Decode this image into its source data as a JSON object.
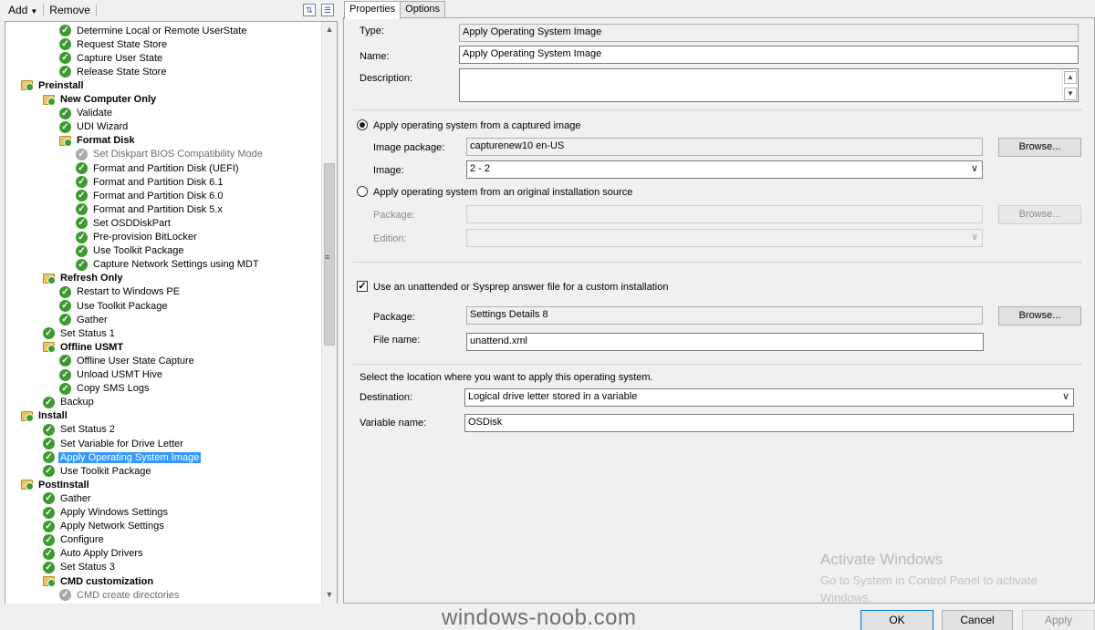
{
  "toolbar": {
    "add_label": "Add",
    "remove_label": "Remove",
    "icons": [
      "properties-icon",
      "options-icon"
    ]
  },
  "tree": {
    "items": [
      {
        "label": "Determine Local or Remote UserState",
        "level": 3,
        "icon": "check",
        "bold": false
      },
      {
        "label": "Request State Store",
        "level": 3,
        "icon": "check",
        "bold": false
      },
      {
        "label": "Capture User State",
        "level": 3,
        "icon": "check",
        "bold": false
      },
      {
        "label": "Release State Store",
        "level": 3,
        "icon": "check",
        "bold": false
      },
      {
        "label": "Preinstall",
        "level": 1,
        "icon": "folder",
        "bold": true
      },
      {
        "label": "New Computer Only",
        "level": 2,
        "icon": "folder",
        "bold": true
      },
      {
        "label": "Validate",
        "level": 3,
        "icon": "check",
        "bold": false
      },
      {
        "label": "UDI Wizard",
        "level": 3,
        "icon": "check",
        "bold": false
      },
      {
        "label": "Format Disk",
        "level": 3,
        "icon": "folder",
        "bold": true
      },
      {
        "label": "Set Diskpart BIOS Compatibility Mode",
        "level": 4,
        "icon": "grey",
        "bold": false,
        "disabled": true
      },
      {
        "label": "Format and Partition Disk (UEFI)",
        "level": 4,
        "icon": "check",
        "bold": false
      },
      {
        "label": "Format and Partition Disk 6.1",
        "level": 4,
        "icon": "check",
        "bold": false
      },
      {
        "label": "Format and Partition Disk 6.0",
        "level": 4,
        "icon": "check",
        "bold": false
      },
      {
        "label": "Format and Partition Disk 5.x",
        "level": 4,
        "icon": "check",
        "bold": false
      },
      {
        "label": "Set OSDDiskPart",
        "level": 4,
        "icon": "check",
        "bold": false
      },
      {
        "label": "Pre-provision BitLocker",
        "level": 4,
        "icon": "check",
        "bold": false
      },
      {
        "label": "Use Toolkit Package",
        "level": 4,
        "icon": "check",
        "bold": false
      },
      {
        "label": "Capture Network Settings using MDT",
        "level": 4,
        "icon": "check",
        "bold": false
      },
      {
        "label": "Refresh Only",
        "level": 2,
        "icon": "folder",
        "bold": true
      },
      {
        "label": "Restart to Windows PE",
        "level": 3,
        "icon": "check",
        "bold": false
      },
      {
        "label": "Use Toolkit Package",
        "level": 3,
        "icon": "check",
        "bold": false
      },
      {
        "label": "Gather",
        "level": 3,
        "icon": "check",
        "bold": false
      },
      {
        "label": "Set Status 1",
        "level": 2,
        "icon": "check",
        "bold": false
      },
      {
        "label": "Offline USMT",
        "level": 2,
        "icon": "folder",
        "bold": true
      },
      {
        "label": "Offline User State Capture",
        "level": 3,
        "icon": "check",
        "bold": false
      },
      {
        "label": "Unload USMT Hive",
        "level": 3,
        "icon": "check",
        "bold": false
      },
      {
        "label": "Copy SMS Logs",
        "level": 3,
        "icon": "check",
        "bold": false
      },
      {
        "label": "Backup",
        "level": 2,
        "icon": "check",
        "bold": false
      },
      {
        "label": "Install",
        "level": 1,
        "icon": "folder",
        "bold": true
      },
      {
        "label": "Set Status 2",
        "level": 2,
        "icon": "check",
        "bold": false
      },
      {
        "label": "Set Variable for Drive Letter",
        "level": 2,
        "icon": "check",
        "bold": false
      },
      {
        "label": "Apply Operating System Image",
        "level": 2,
        "icon": "check",
        "bold": false,
        "selected": true
      },
      {
        "label": "Use Toolkit Package",
        "level": 2,
        "icon": "check",
        "bold": false
      },
      {
        "label": "PostInstall",
        "level": 1,
        "icon": "folder",
        "bold": true
      },
      {
        "label": "Gather",
        "level": 2,
        "icon": "check",
        "bold": false
      },
      {
        "label": "Apply Windows Settings",
        "level": 2,
        "icon": "check",
        "bold": false
      },
      {
        "label": "Apply Network Settings",
        "level": 2,
        "icon": "check",
        "bold": false
      },
      {
        "label": "Configure",
        "level": 2,
        "icon": "check",
        "bold": false
      },
      {
        "label": "Auto Apply Drivers",
        "level": 2,
        "icon": "check",
        "bold": false
      },
      {
        "label": "Set Status 3",
        "level": 2,
        "icon": "check",
        "bold": false
      },
      {
        "label": "CMD customization",
        "level": 2,
        "icon": "folder",
        "bold": true
      },
      {
        "label": "CMD create directories",
        "level": 3,
        "icon": "grey",
        "bold": false,
        "disabled": true
      }
    ]
  },
  "tabs": [
    {
      "label": "Properties",
      "active": true
    },
    {
      "label": "Options",
      "active": false
    }
  ],
  "form": {
    "type_label": "Type:",
    "type_value": "Apply Operating System Image",
    "name_label": "Name:",
    "name_value": "Apply Operating System Image",
    "description_label": "Description:",
    "description_value": "",
    "radio_captured_label": "Apply operating system from a captured image",
    "radio_captured_selected": true,
    "image_package_label": "Image package:",
    "image_package_value": "capturenew10  en-US",
    "browse_label": "Browse...",
    "image_label": "Image:",
    "image_value": "2 - 2",
    "radio_original_label": "Apply operating system from an original installation source",
    "radio_original_selected": false,
    "package_label": "Package:",
    "package_value": "",
    "edition_label": "Edition:",
    "edition_value": "",
    "unattend_label": "Use an unattended or Sysprep answer file for a custom installation",
    "unattend_checked": true,
    "answer_package_label": "Package:",
    "answer_package_value": "Settings Details 8",
    "file_name_label": "File name:",
    "file_name_value": "unattend.xml",
    "location_prompt": "Select the location where you want to apply this operating system.",
    "destination_label": "Destination:",
    "destination_value": "Logical drive letter stored in a variable",
    "variable_name_label": "Variable name:",
    "variable_name_value": "OSDisk"
  },
  "watermark": {
    "title": "Activate Windows",
    "subtitle": "Go to System in Control Panel to activate Windows."
  },
  "footer": {
    "site_text": "windows-noob.com",
    "ok_label": "OK",
    "cancel_label": "Cancel",
    "apply_label": "Apply"
  },
  "colors": {
    "selection": "#3399ff",
    "success": "#3c9a2f",
    "folder": "#e8c766",
    "default_button_border": "#0078d7"
  }
}
